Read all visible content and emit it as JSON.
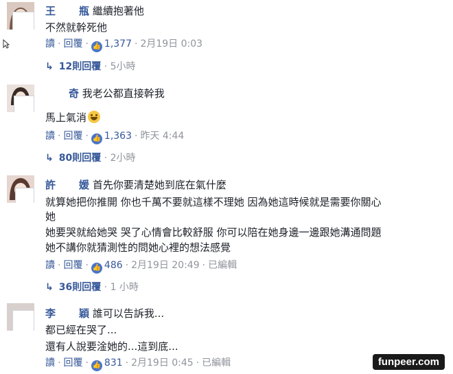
{
  "comments": [
    {
      "name_first": "王",
      "name_last": "瓶",
      "lines": [
        "繼續抱著他",
        "不然就幹死他"
      ],
      "action_reply": "讀",
      "action_reply2": "回覆",
      "likes": "1,377",
      "time": "2月19日 0:03",
      "edited": "",
      "reply_count": "12則回覆",
      "reply_time": "5小時"
    },
    {
      "name_first": "",
      "name_last": "奇",
      "lines": [
        "我老公都直接幹我",
        "馬上氣消"
      ],
      "action_reply": "讀",
      "action_reply2": "回覆",
      "likes": "1,363",
      "time": "昨天 4:44",
      "edited": "",
      "reply_count": "80則回覆",
      "reply_time": "2小時"
    },
    {
      "name_first": "許",
      "name_last": "媛",
      "lines": [
        "首先你要清楚她到底在氣什麼",
        "就算她把你推開 你也千萬不要就這樣不理她 因為她這時候就是需要你關心",
        "她",
        "她要哭就給她哭 哭了心情會比較舒服 你可以陪在她身邊一邊跟她溝通問題",
        "她不講你就猜測性的問她心裡的想法感覺"
      ],
      "action_reply": "讀",
      "action_reply2": "回覆",
      "likes": "486",
      "time": "2月19日 20:49",
      "edited": "已編輯",
      "reply_count": "36則回覆",
      "reply_time": "1 小時"
    },
    {
      "name_first": "李",
      "name_last": "穎",
      "lines": [
        "誰可以告訴我...",
        "都已經在哭了...",
        "還有人說要淦她的...這到底..."
      ],
      "action_reply": "讀",
      "action_reply2": "回覆",
      "likes": "831",
      "time": "2月19日 0:45",
      "edited": "已編輯",
      "reply_count": "",
      "reply_time": ""
    }
  ],
  "watermark": "funpeer.com",
  "icons": {
    "like": "thumbs-up-icon",
    "reply_arrow": "reply-arrow-icon",
    "emoji": "grinning-emoji-icon",
    "cursor": "mouse-cursor-icon"
  }
}
